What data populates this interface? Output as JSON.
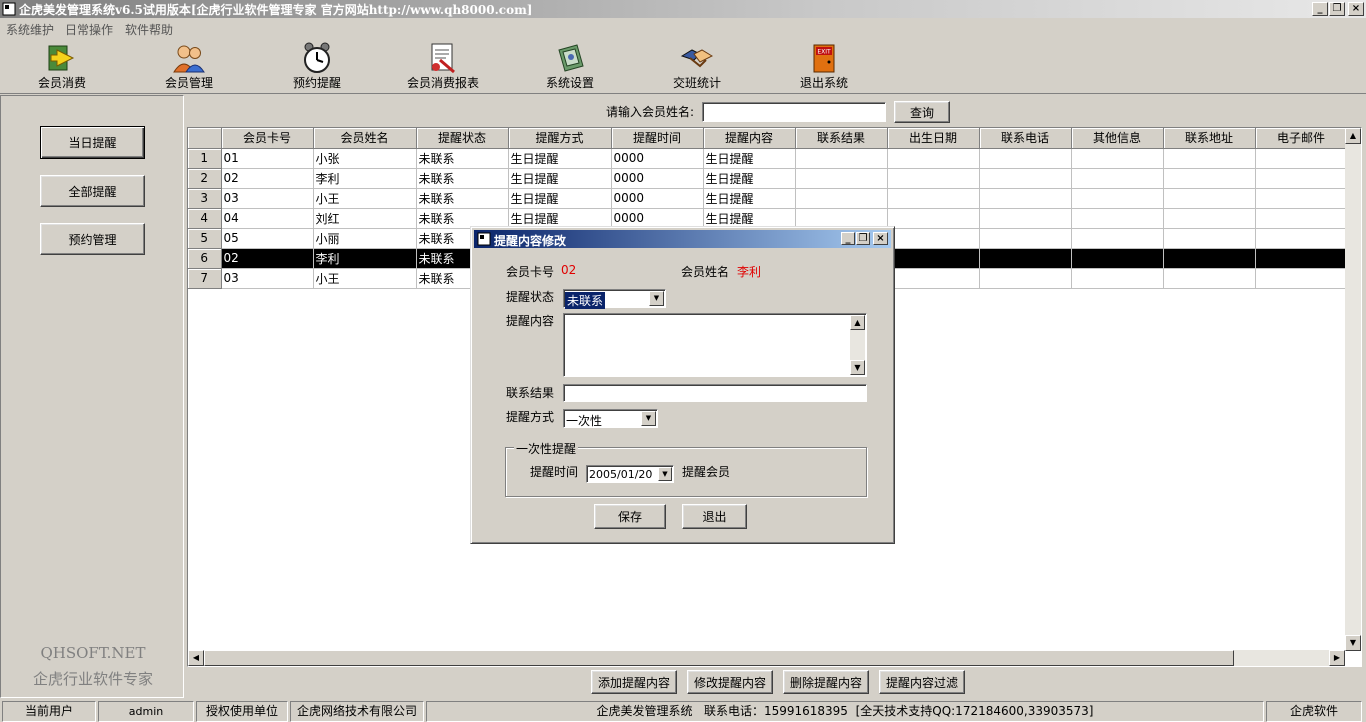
{
  "window": {
    "title": "企虎美发管理系统v6.5试用版本[企虎行业软件管理专家 官方网站http://www.qh8000.com]",
    "min": "_",
    "max": "❐",
    "close": "×"
  },
  "menu": [
    "系统维护",
    "日常操作",
    "软件帮助"
  ],
  "toolbar": [
    {
      "label": "会员消费",
      "icon": "arrow-card-icon"
    },
    {
      "label": "会员管理",
      "icon": "users-icon"
    },
    {
      "label": "预约提醒",
      "icon": "alarm-clock-icon"
    },
    {
      "label": "会员消费报表",
      "icon": "report-icon"
    },
    {
      "label": "系统设置",
      "icon": "settings-book-icon"
    },
    {
      "label": "交班统计",
      "icon": "handshake-icon"
    },
    {
      "label": "退出系统",
      "icon": "exit-door-icon"
    }
  ],
  "exit_sign": "EXIT",
  "left": {
    "buttons": [
      "当日提醒",
      "全部提醒",
      "预约管理"
    ],
    "brand_line1": "QHSOFT.NET",
    "brand_line2": "企虎行业软件专家"
  },
  "search": {
    "label": "请输入会员姓名:",
    "value": "",
    "button": "查询"
  },
  "grid": {
    "columns": [
      "会员卡号",
      "会员姓名",
      "提醒状态",
      "提醒方式",
      "提醒时间",
      "提醒内容",
      "联系结果",
      "出生日期",
      "联系电话",
      "其他信息",
      "联系地址",
      "电子邮件"
    ],
    "selected_row": 6,
    "rows": [
      {
        "n": "1",
        "card": "01",
        "name": "小张",
        "status": "未联系",
        "method": "生日提醒",
        "time": "0000",
        "content": "生日提醒"
      },
      {
        "n": "2",
        "card": "02",
        "name": "李利",
        "status": "未联系",
        "method": "生日提醒",
        "time": "0000",
        "content": "生日提醒"
      },
      {
        "n": "3",
        "card": "03",
        "name": "小王",
        "status": "未联系",
        "method": "生日提醒",
        "time": "0000",
        "content": "生日提醒"
      },
      {
        "n": "4",
        "card": "04",
        "name": "刘红",
        "status": "未联系",
        "method": "生日提醒",
        "time": "0000",
        "content": "生日提醒"
      },
      {
        "n": "5",
        "card": "05",
        "name": "小丽",
        "status": "未联系",
        "method": "",
        "time": "",
        "content": ""
      },
      {
        "n": "6",
        "card": "02",
        "name": "李利",
        "status": "未联系",
        "method": "",
        "time": "",
        "content": ""
      },
      {
        "n": "7",
        "card": "03",
        "name": "小王",
        "status": "未联系",
        "method": "",
        "time": "",
        "content": ""
      }
    ]
  },
  "scroll": {
    "up": "▲",
    "down": "▼",
    "left": "◀",
    "right": "▶"
  },
  "bottom_buttons": [
    "添加提醒内容",
    "修改提醒内容",
    "删除提醒内容",
    "提醒内容过滤"
  ],
  "status": {
    "user_label": "当前用户",
    "user": "admin",
    "licensee_label": "授权使用单位",
    "licensee": "企虎网络技术有限公司",
    "info": "企虎美发管理系统   联系电话：15991618395  [全天技术支持QQ:172184600,33903573]",
    "brand": "企虎软件"
  },
  "dialog": {
    "title": "提醒内容修改",
    "card_label": "会员卡号",
    "card_value": "02",
    "name_label": "会员姓名",
    "name_value": "李利",
    "status_label": "提醒状态",
    "status_value": "未联系",
    "content_label": "提醒内容",
    "content_value": "",
    "result_label": "联系结果",
    "result_value": "",
    "method_label": "提醒方式",
    "method_value": "一次性",
    "group_title": "一次性提醒",
    "time_label": "提醒时间",
    "time_value": "2005/01/20",
    "member_label": "提醒会员",
    "save": "保存",
    "exit": "退出",
    "combo_arrow": "▼"
  }
}
